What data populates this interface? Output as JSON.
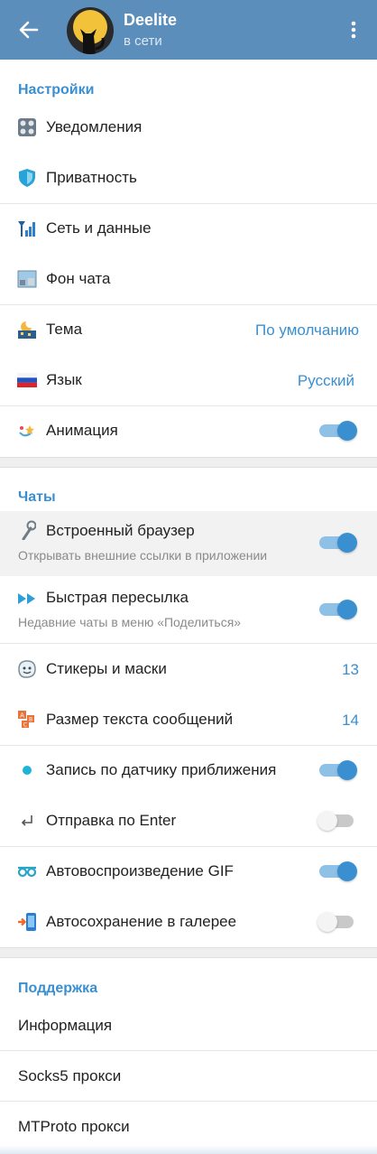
{
  "header": {
    "name": "Deelite",
    "status": "в сети",
    "bg_color": "#5b8ebb"
  },
  "settings": {
    "title": "Настройки",
    "items": [
      {
        "label": "Уведомления",
        "icon": "notifications-icon"
      },
      {
        "label": "Приватность",
        "icon": "shield-icon"
      },
      {
        "label": "Сеть и данные",
        "icon": "signal-icon"
      },
      {
        "label": "Фон чата",
        "icon": "wallpaper-icon"
      },
      {
        "label": "Тема",
        "icon": "theme-icon",
        "value": "По умолчанию"
      },
      {
        "label": "Язык",
        "icon": "russian-flag-icon",
        "value": "Русский"
      },
      {
        "label": "Анимация",
        "icon": "animation-icon",
        "toggle": true
      }
    ]
  },
  "chats": {
    "title": "Чаты",
    "items": [
      {
        "label": "Встроенный браузер",
        "sub": "Открывать внешние ссылки в приложении",
        "icon": "browser-icon",
        "toggle": true
      },
      {
        "label": "Быстрая пересылка",
        "sub": "Недавние чаты в меню «Поделиться»",
        "icon": "fast-forward-icon",
        "toggle": true
      },
      {
        "label": "Стикеры и маски",
        "icon": "sticker-icon",
        "value": "13"
      },
      {
        "label": "Размер текста сообщений",
        "icon": "text-size-icon",
        "value": "14"
      },
      {
        "label": "Запись по датчику приближения",
        "icon": "proximity-dot-icon",
        "toggle": true
      },
      {
        "label": "Отправка по Enter",
        "icon": "enter-icon",
        "toggle": false
      },
      {
        "label": "Автовоспроизведение GIF",
        "icon": "gif-loop-icon",
        "toggle": true
      },
      {
        "label": "Автосохранение в галерее",
        "icon": "save-to-gallery-icon",
        "toggle": false
      }
    ]
  },
  "support": {
    "title": "Поддержка",
    "items": [
      {
        "label": "Информация"
      },
      {
        "label": "Socks5 прокси"
      },
      {
        "label": "MTProto прокси"
      }
    ]
  },
  "colors": {
    "accent": "#3a8fd0",
    "toggle_on_track": "#8fc0e6"
  }
}
